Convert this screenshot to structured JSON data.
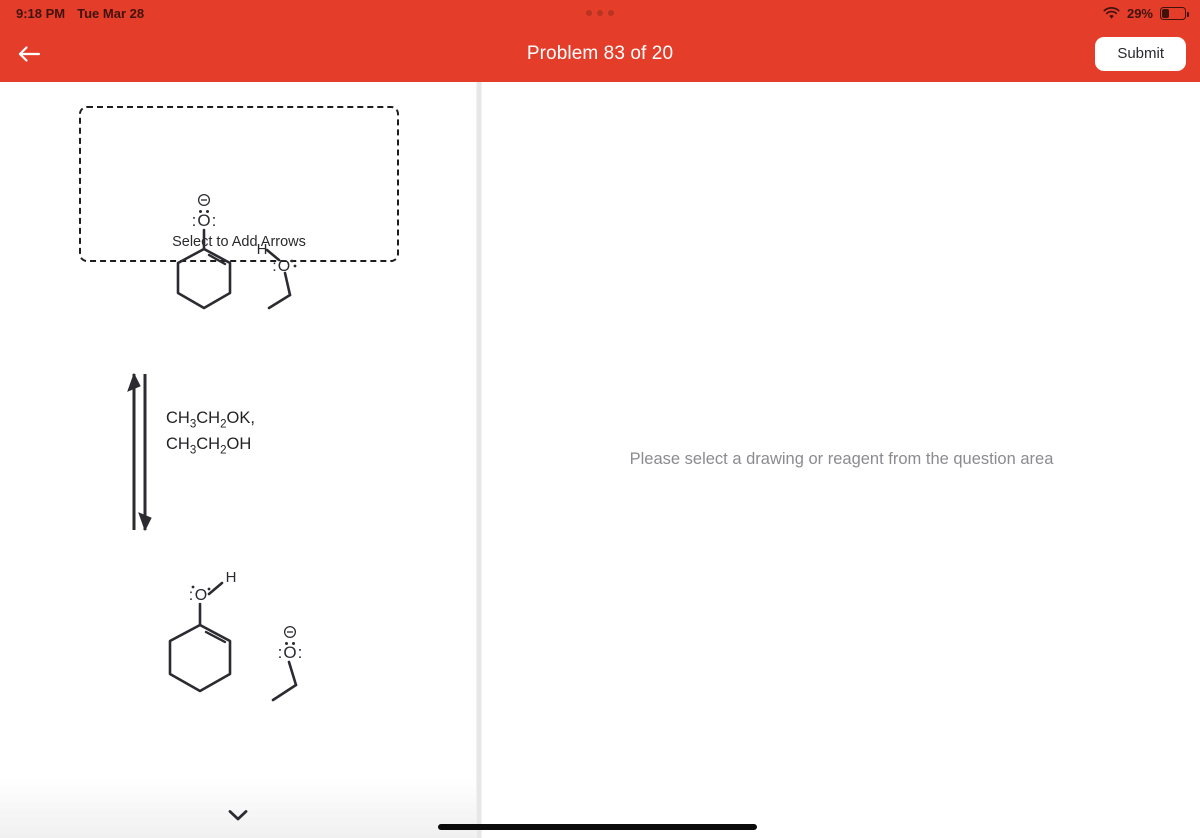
{
  "status_bar": {
    "time": "9:18 PM",
    "date": "Tue Mar 28",
    "battery_percent": "29%",
    "wifi_icon": "wifi-icon",
    "battery_icon": "battery-icon",
    "multitask_icon": "more-dots-icon"
  },
  "nav_bar": {
    "back_icon": "arrow-left-icon",
    "title": "Problem 83 of 20",
    "submit_label": "Submit",
    "background_color": "#E43E2B",
    "title_color": "#FFFFFF"
  },
  "question_panel": {
    "drawing_box": {
      "hint_label": "Select to Add Arrows",
      "species": [
        {
          "name": "cyclohexenolate",
          "atom_labels": [
            "O"
          ],
          "charge_label": "⊖",
          "description": "cyclohexene ring with negatively charged oxygen"
        },
        {
          "name": "ethanol",
          "atom_labels": [
            "H",
            "O"
          ],
          "description": "H-O-CH2CH3"
        }
      ]
    },
    "reaction_arrow": {
      "type": "equilibrium-vertical",
      "reagent_lines": [
        "CH3CH2OK,",
        "CH3CH2OH"
      ]
    },
    "product_drawing": {
      "species": [
        {
          "name": "cyclohexenol",
          "atom_labels": [
            "O",
            "H"
          ],
          "description": "cyclohexene ring with hydroxyl group"
        },
        {
          "name": "ethoxide",
          "atom_labels": [
            "O"
          ],
          "charge_label": "⊖",
          "description": "negatively charged oxygen with ethyl chain"
        }
      ]
    },
    "collapse_icon": "chevron-down-icon"
  },
  "answer_panel": {
    "empty_message": "Please select a drawing or reagent from the question area",
    "message_color": "#8B8B90"
  },
  "system": {
    "home_indicator": "home-indicator"
  }
}
